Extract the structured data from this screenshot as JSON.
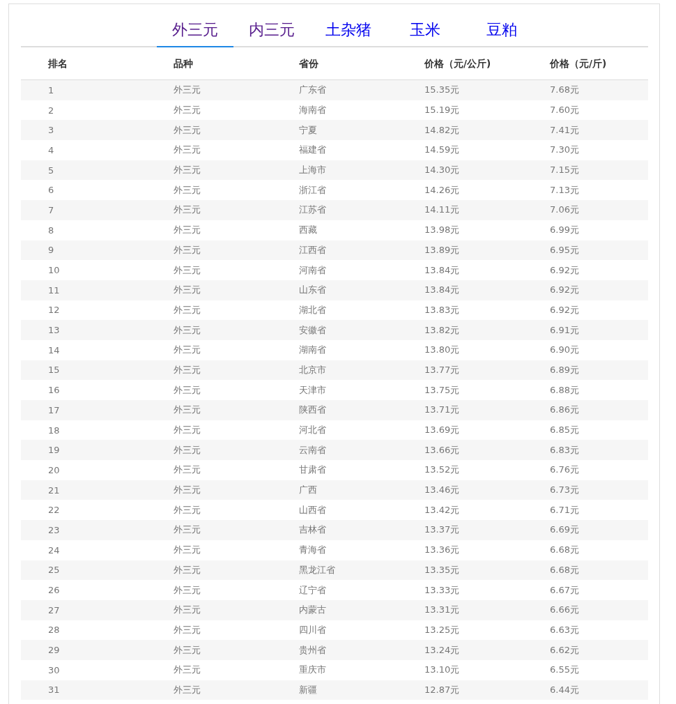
{
  "tabs": [
    {
      "label": "外三元",
      "selected": true,
      "visited": true
    },
    {
      "label": "内三元",
      "selected": false,
      "visited": true
    },
    {
      "label": "土杂猪",
      "selected": false,
      "visited": false
    },
    {
      "label": "玉米",
      "selected": false,
      "visited": false
    },
    {
      "label": "豆粕",
      "selected": false,
      "visited": false
    }
  ],
  "table": {
    "columns": [
      "排名",
      "品种",
      "省份",
      "价格（元/公斤)",
      "价格（元/斤)"
    ],
    "rows": [
      [
        "1",
        "外三元",
        "广东省",
        "15.35元",
        "7.68元"
      ],
      [
        "2",
        "外三元",
        "海南省",
        "15.19元",
        "7.60元"
      ],
      [
        "3",
        "外三元",
        "宁夏",
        "14.82元",
        "7.41元"
      ],
      [
        "4",
        "外三元",
        "福建省",
        "14.59元",
        "7.30元"
      ],
      [
        "5",
        "外三元",
        "上海市",
        "14.30元",
        "7.15元"
      ],
      [
        "6",
        "外三元",
        "浙江省",
        "14.26元",
        "7.13元"
      ],
      [
        "7",
        "外三元",
        "江苏省",
        "14.11元",
        "7.06元"
      ],
      [
        "8",
        "外三元",
        "西藏",
        "13.98元",
        "6.99元"
      ],
      [
        "9",
        "外三元",
        "江西省",
        "13.89元",
        "6.95元"
      ],
      [
        "10",
        "外三元",
        "河南省",
        "13.84元",
        "6.92元"
      ],
      [
        "11",
        "外三元",
        "山东省",
        "13.84元",
        "6.92元"
      ],
      [
        "12",
        "外三元",
        "湖北省",
        "13.83元",
        "6.92元"
      ],
      [
        "13",
        "外三元",
        "安徽省",
        "13.82元",
        "6.91元"
      ],
      [
        "14",
        "外三元",
        "湖南省",
        "13.80元",
        "6.90元"
      ],
      [
        "15",
        "外三元",
        "北京市",
        "13.77元",
        "6.89元"
      ],
      [
        "16",
        "外三元",
        "天津市",
        "13.75元",
        "6.88元"
      ],
      [
        "17",
        "外三元",
        "陕西省",
        "13.71元",
        "6.86元"
      ],
      [
        "18",
        "外三元",
        "河北省",
        "13.69元",
        "6.85元"
      ],
      [
        "19",
        "外三元",
        "云南省",
        "13.66元",
        "6.83元"
      ],
      [
        "20",
        "外三元",
        "甘肃省",
        "13.52元",
        "6.76元"
      ],
      [
        "21",
        "外三元",
        "广西",
        "13.46元",
        "6.73元"
      ],
      [
        "22",
        "外三元",
        "山西省",
        "13.42元",
        "6.71元"
      ],
      [
        "23",
        "外三元",
        "吉林省",
        "13.37元",
        "6.69元"
      ],
      [
        "24",
        "外三元",
        "青海省",
        "13.36元",
        "6.68元"
      ],
      [
        "25",
        "外三元",
        "黑龙江省",
        "13.35元",
        "6.68元"
      ],
      [
        "26",
        "外三元",
        "辽宁省",
        "13.33元",
        "6.67元"
      ],
      [
        "27",
        "外三元",
        "内蒙古",
        "13.31元",
        "6.66元"
      ],
      [
        "28",
        "外三元",
        "四川省",
        "13.25元",
        "6.63元"
      ],
      [
        "29",
        "外三元",
        "贵州省",
        "13.24元",
        "6.62元"
      ],
      [
        "30",
        "外三元",
        "重庆市",
        "13.10元",
        "6.55元"
      ],
      [
        "31",
        "外三元",
        "新疆",
        "12.87元",
        "6.44元"
      ]
    ]
  }
}
